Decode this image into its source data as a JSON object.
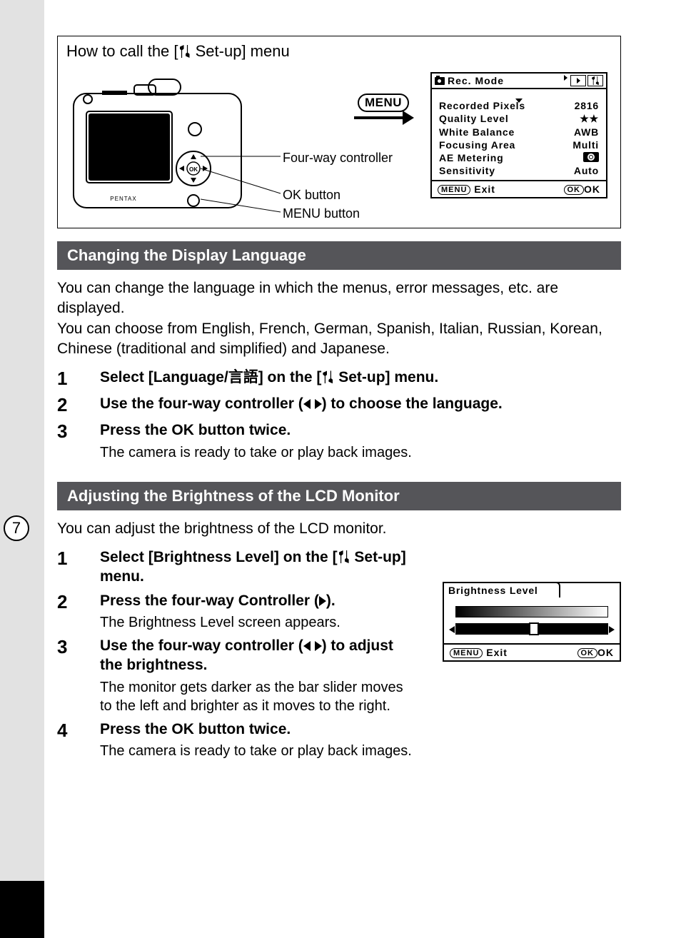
{
  "diagram": {
    "title_prefix": "How to call the [",
    "title_suffix": " Set-up] menu",
    "callout_fourway": "Four-way controller",
    "callout_ok": "OK button",
    "callout_menu": "MENU button",
    "menu_icon": "MENU"
  },
  "lcd": {
    "header": "Rec. Mode",
    "rows": [
      {
        "label": "Recorded Pixels",
        "value": "2816"
      },
      {
        "label": "Quality Level",
        "value": "★★"
      },
      {
        "label": "White Balance",
        "value": "AWB"
      },
      {
        "label": "Focusing Area",
        "value": "Multi"
      },
      {
        "label": "AE Metering",
        "value": ""
      },
      {
        "label": "Sensitivity",
        "value": "Auto"
      }
    ],
    "footer_exit": "Exit",
    "footer_ok": "OK",
    "footer_menu_icon": "MENU",
    "footer_ok_icon": "OK"
  },
  "section1": {
    "title": "Changing the Display Language",
    "body": "You can change the language in which the menus, error messages, etc. are displayed.\nYou can choose from English, French, German, Spanish, Italian, Russian, Korean, Chinese (traditional and simplified) and Japanese.",
    "steps": [
      {
        "n": "1",
        "bold": "Select [Language/言語] on the [   Set-up] menu.",
        "jp": "言語"
      },
      {
        "n": "2",
        "bold": "Use the four-way controller (◀▶) to choose the language."
      },
      {
        "n": "3",
        "bold": "Press the OK button twice.",
        "desc": "The camera is ready to take or play back images."
      }
    ]
  },
  "section2": {
    "title": "Adjusting the Brightness of the LCD Monitor",
    "intro": "You can adjust the brightness of the LCD monitor.",
    "steps": [
      {
        "n": "1",
        "bold": "Select [Brightness Level] on the [   Set-up] menu."
      },
      {
        "n": "2",
        "bold": "Press the four-way Controller (▶).",
        "desc": "The Brightness Level screen appears."
      },
      {
        "n": "3",
        "bold": "Use the four-way controller (◀▶) to adjust the brightness.",
        "desc": "The monitor gets darker as the bar slider moves to the left and brighter as it moves to the right."
      },
      {
        "n": "4",
        "bold": "Press the OK button twice.",
        "desc": "The camera is ready to take or play back images."
      }
    ],
    "brightness_lcd": {
      "title": "Brightness Level",
      "exit": "Exit",
      "ok": "OK",
      "menu_icon": "MENU",
      "ok_icon": "OK"
    }
  },
  "page_number": "7"
}
